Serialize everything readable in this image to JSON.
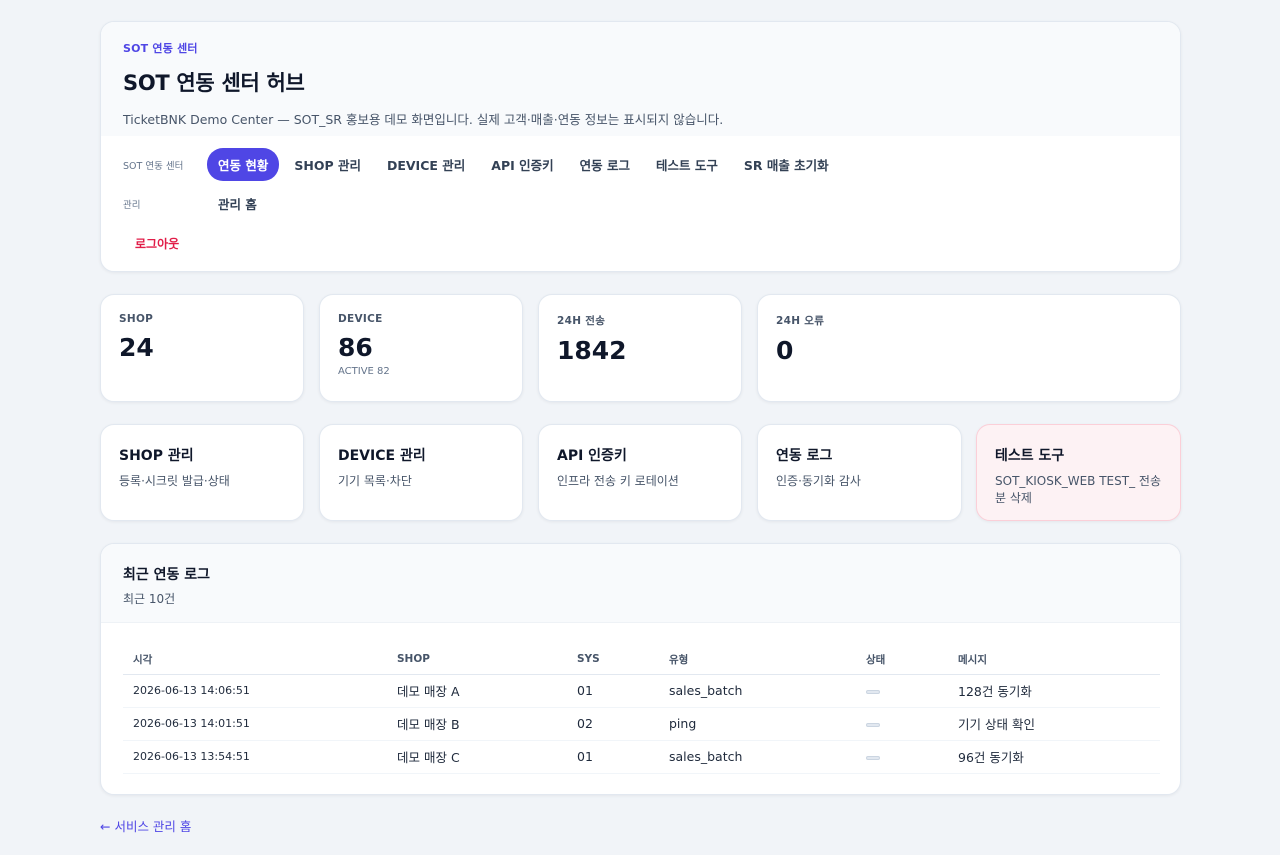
{
  "header": {
    "eyebrow": "SOT 연동 센터",
    "title": "SOT 연동 센터 허브",
    "description": "TicketBNK Demo Center — SOT_SR 홍보용 데모 화면입니다. 실제 고객·매출·연동 정보는 표시되지 않습니다."
  },
  "nav": {
    "group1_label": "SOT 연동 센터",
    "items": [
      "연동 현황",
      "SHOP 관리",
      "DEVICE 관리",
      "API 인증키",
      "연동 로그",
      "테스트 도구",
      "SR 매출 초기화"
    ],
    "active_index": 0,
    "group2_label": "관리",
    "admin_home": "관리 홈",
    "logout": "로그아웃"
  },
  "stats": [
    {
      "label": "SHOP",
      "value": "24",
      "sub": ""
    },
    {
      "label": "DEVICE",
      "value": "86",
      "sub": "ACTIVE 82"
    },
    {
      "label": "24H 전송",
      "value": "1842",
      "sub": ""
    },
    {
      "label": "24H 오류",
      "value": "0",
      "sub": ""
    }
  ],
  "quick_links": [
    {
      "title": "SHOP 관리",
      "desc": "등록·시크릿 발급·상태"
    },
    {
      "title": "DEVICE 관리",
      "desc": "기기 목록·차단"
    },
    {
      "title": "API 인증키",
      "desc": "인프라 전송 키 로테이션"
    },
    {
      "title": "연동 로그",
      "desc": "인증·동기화 감사"
    },
    {
      "title": "테스트 도구",
      "desc": "SOT_KIOSK_WEB TEST_ 전송분 삭제"
    }
  ],
  "logs": {
    "title": "최근 연동 로그",
    "subtitle": "최근 10건",
    "columns": [
      "시각",
      "SHOP",
      "SYS",
      "유형",
      "상태",
      "메시지"
    ],
    "rows": [
      {
        "time": "2026-06-13 14:06:51",
        "shop": "데모 매장 A",
        "sys": "01",
        "type": "sales_batch",
        "message": "128건 동기화"
      },
      {
        "time": "2026-06-13 14:01:51",
        "shop": "데모 매장 B",
        "sys": "02",
        "type": "ping",
        "message": "기기 상태 확인"
      },
      {
        "time": "2026-06-13 13:54:51",
        "shop": "데모 매장 C",
        "sys": "01",
        "type": "sales_batch",
        "message": "96건 동기화"
      }
    ]
  },
  "footer": {
    "back_link": "← 서비스 관리 홈"
  },
  "colors": {
    "accent": "#4f46e5",
    "danger": "#e11d48",
    "warn_card_bg": "#fdf2f4"
  }
}
